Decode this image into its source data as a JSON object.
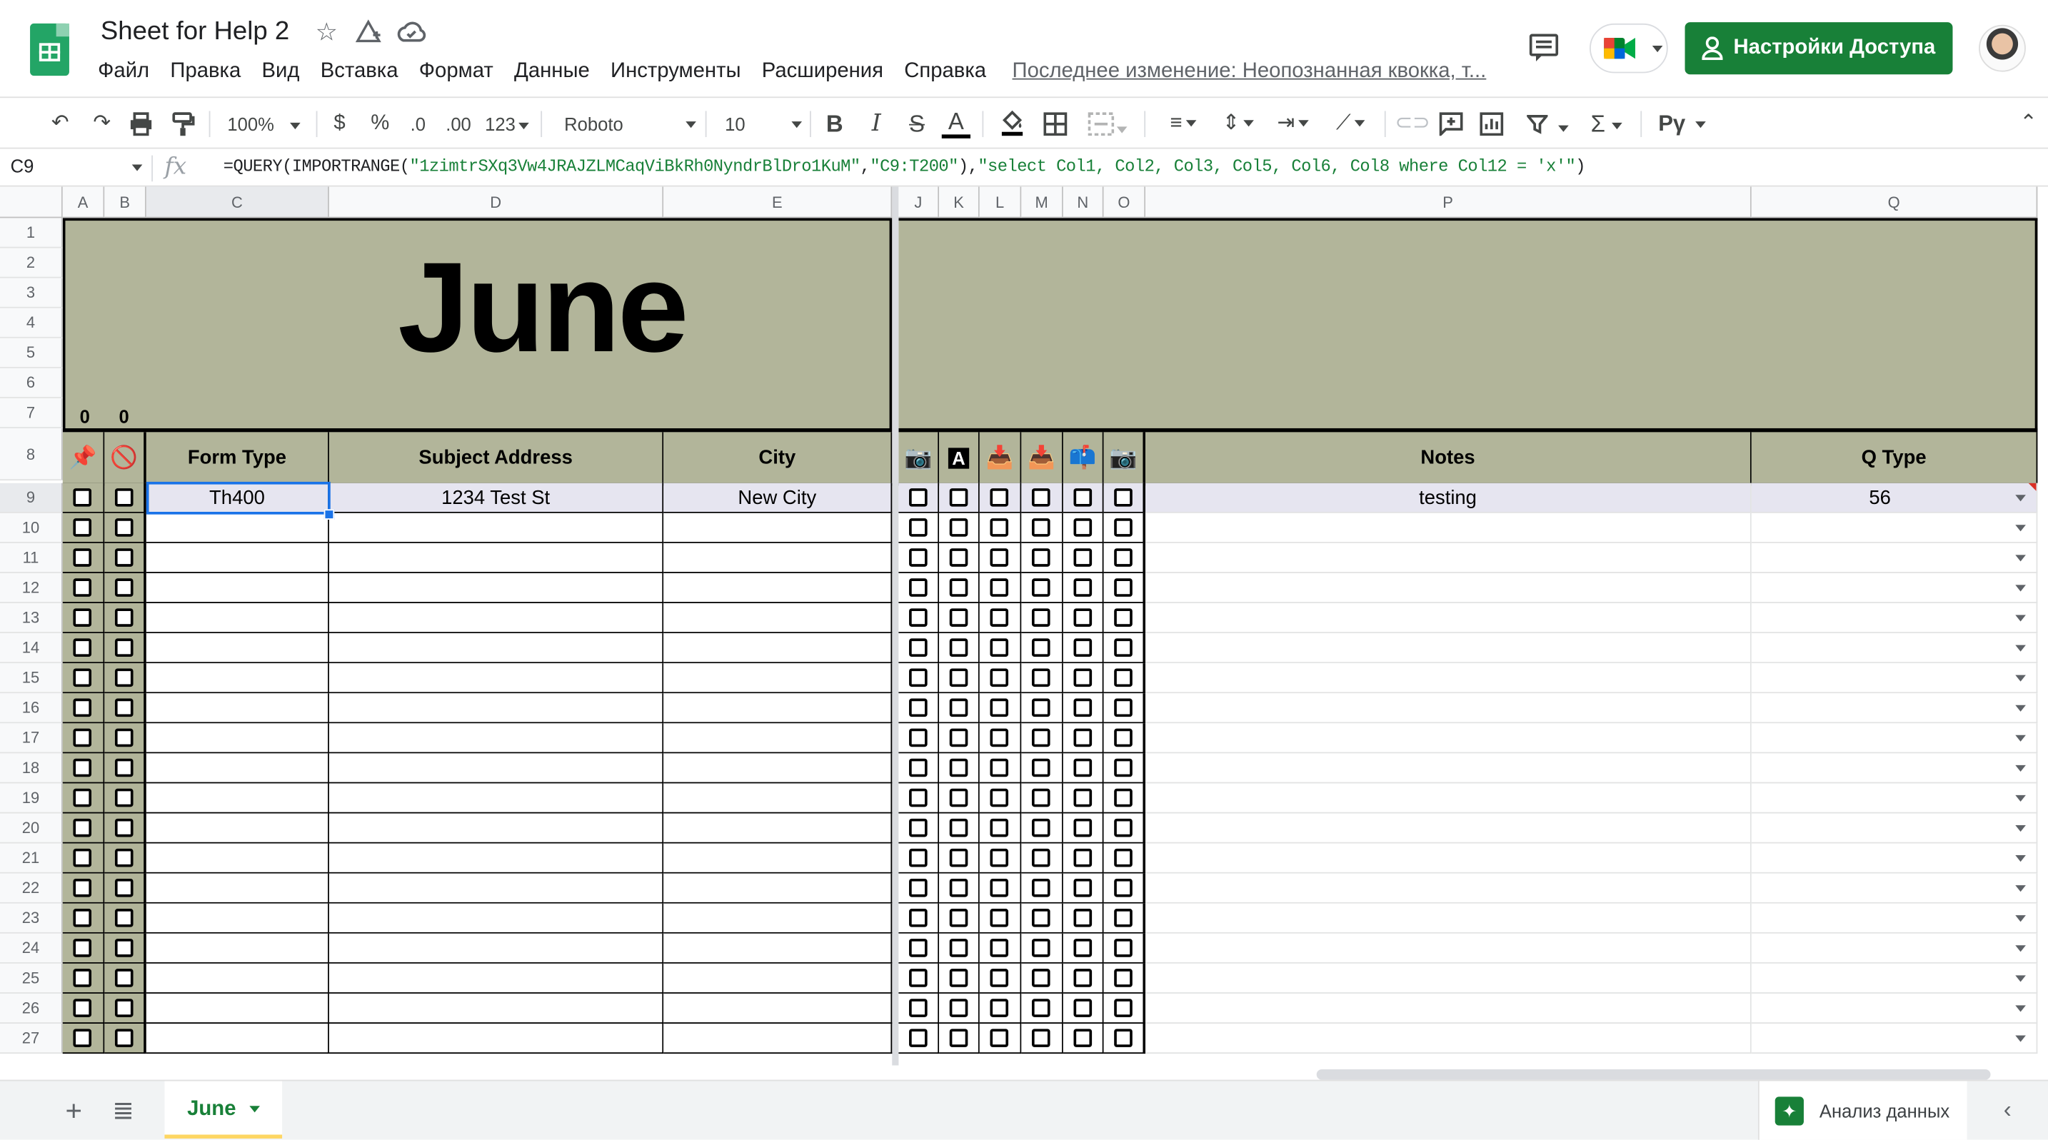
{
  "app": {
    "title": "Sheet for Help 2",
    "menu": [
      "Файл",
      "Правка",
      "Вид",
      "Вставка",
      "Формат",
      "Данные",
      "Инструменты",
      "Расширения",
      "Справка"
    ],
    "last_edit": "Последнее изменение: Неопознанная квокка, т...",
    "share_label": "Настройки Доступа"
  },
  "toolbar": {
    "zoom": "100%",
    "currency": "$",
    "percent": "%",
    "dec_decrease": ".0",
    "dec_increase": ".00",
    "format_more": "123",
    "font": "Roboto",
    "font_size": "10"
  },
  "formula_bar": {
    "cell_ref": "C9",
    "fx": "fx",
    "formula_prefix": "=QUERY(IMPORTRANGE(",
    "formula_key": "\"1zimtrSXq3Vw4JRAJZLMCaqViBkRh0NyndrBlDro1KuM\"",
    "formula_comma": ",",
    "formula_range": "\"C9:T200\"",
    "formula_mid": "),",
    "formula_query": "\"select Col1, Col2, Col3, Col5, Col6, Col8 where Col12 = 'x'\"",
    "formula_end": ")"
  },
  "sheet": {
    "columns": [
      "A",
      "B",
      "C",
      "D",
      "E",
      "J",
      "K",
      "L",
      "M",
      "N",
      "O",
      "P",
      "Q"
    ],
    "row_numbers": [
      "1",
      "2",
      "3",
      "4",
      "5",
      "6",
      "7",
      "8",
      "9",
      "10",
      "11",
      "12",
      "13",
      "14",
      "15",
      "16",
      "17",
      "18",
      "19",
      "20",
      "21",
      "22",
      "23",
      "24",
      "25",
      "26",
      "27"
    ],
    "banner_title": "June",
    "counts": [
      "0",
      "0"
    ],
    "headers": {
      "form_type": "Form Type",
      "subject_address": "Subject Address",
      "city": "City",
      "notes": "Notes",
      "q_type": "Q Type"
    },
    "header_icons": [
      "pushpin-icon",
      "prohibited-icon",
      "camera-icon",
      "letter-a-icon",
      "inbox-tray-icon",
      "inbox-tray-icon",
      "mailbox-icon",
      "camera-icon"
    ],
    "rows": [
      {
        "form_type": "Th400",
        "subject_address": "1234 Test St",
        "city": "New City",
        "notes": "testing",
        "q_type": "56"
      }
    ]
  },
  "bottom": {
    "sheet_tab": "June",
    "explore_label": "Анализ данных"
  }
}
